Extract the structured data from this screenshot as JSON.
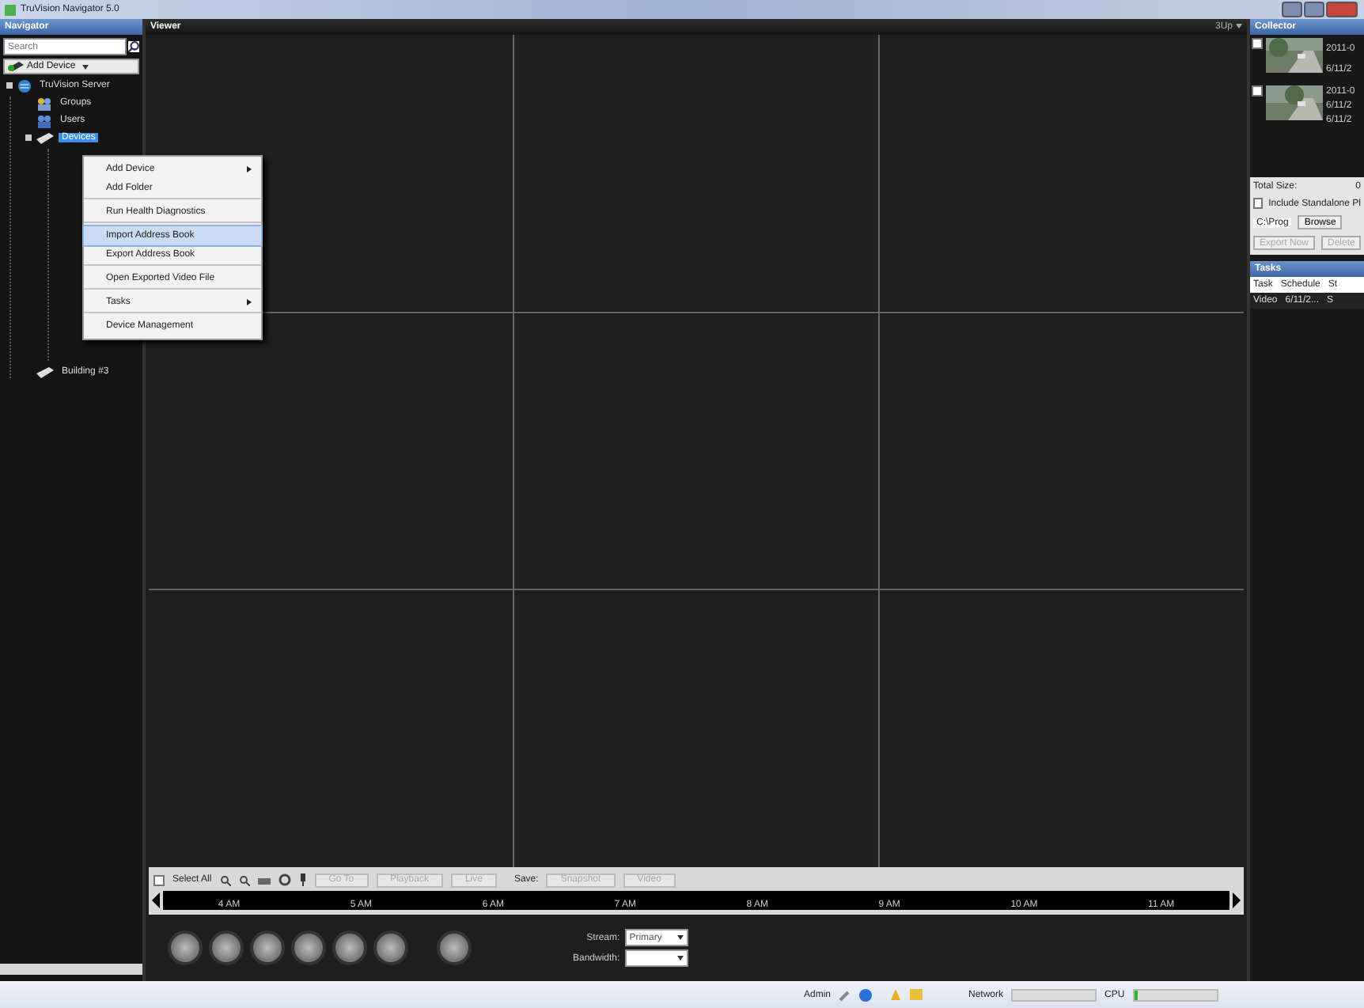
{
  "window": {
    "title": "TruVision Navigator 5.0"
  },
  "navigator": {
    "title": "Navigator",
    "search": {
      "placeholder": "Search"
    },
    "add_device": "Add Device",
    "tree": [
      {
        "label": "TruVision Server",
        "kind": "server",
        "expanded": true,
        "selected": false,
        "children": [
          {
            "label": "Groups",
            "kind": "groups",
            "selected": false
          },
          {
            "label": "Users",
            "kind": "users",
            "selected": false
          },
          {
            "label": "Devices",
            "kind": "device",
            "expanded": true,
            "selected": true
          },
          {
            "label": "Building #3",
            "kind": "device",
            "selected": false
          }
        ]
      }
    ]
  },
  "context_menu": [
    {
      "label": "Add Device",
      "submenu": true,
      "selected": false
    },
    {
      "label": "Add Folder",
      "submenu": false,
      "selected": false,
      "separator_after": true
    },
    {
      "label": "Run Health Diagnostics",
      "submenu": false,
      "selected": false,
      "separator_after": true
    },
    {
      "label": "Import Address Book",
      "submenu": false,
      "selected": true
    },
    {
      "label": "Export Address Book",
      "submenu": false,
      "selected": false,
      "separator_after": true
    },
    {
      "label": "Open Exported Video File",
      "submenu": false,
      "selected": false,
      "separator_after": true
    },
    {
      "label": "Tasks",
      "submenu": true,
      "selected": false,
      "separator_after": true
    },
    {
      "label": "Device Management",
      "submenu": false,
      "selected": false
    }
  ],
  "viewer": {
    "title": "Viewer",
    "layout": "3Up",
    "toolbar": {
      "select_all": {
        "label": "Select All",
        "checked": false
      },
      "buttons": [
        {
          "label": "Go To",
          "disabled": true
        },
        {
          "label": "Playback",
          "disabled": true
        },
        {
          "label": "Live",
          "disabled": true
        }
      ],
      "save_label": "Save:",
      "save_buttons": [
        {
          "label": "Snapshot",
          "disabled": true
        },
        {
          "label": "Video",
          "disabled": true
        }
      ]
    },
    "timeline": [
      "4 AM",
      "5 AM",
      "6 AM",
      "7 AM",
      "8 AM",
      "9 AM",
      "10 AM",
      "11 AM"
    ],
    "stream": {
      "label": "Stream:",
      "value": "Primary"
    },
    "bandwidth": {
      "label": "Bandwidth:"
    }
  },
  "collector": {
    "title": "Collector",
    "items": [
      {
        "checked": false,
        "lines": [
          "2011-0",
          "6/11/2"
        ]
      },
      {
        "checked": false,
        "lines": [
          "2011-0",
          "6/11/2",
          "6/11/2"
        ]
      }
    ],
    "total_size_label": "Total Size:",
    "total_size": "0",
    "include_standalone": {
      "label": "Include Standalone Pl",
      "checked": false
    },
    "path": "C:\\Prog",
    "browse": "Browse",
    "export_now": "Export Now",
    "delete": "Delete"
  },
  "tasks": {
    "title": "Tasks",
    "columns": [
      "Task",
      "Schedule",
      "St"
    ],
    "rows": [
      [
        "Video",
        "6/11/2...",
        "S"
      ]
    ]
  },
  "status_bar": {
    "user": "Admin",
    "network_label": "Network",
    "cpu": {
      "label": "CPU",
      "level": 0.05
    }
  }
}
